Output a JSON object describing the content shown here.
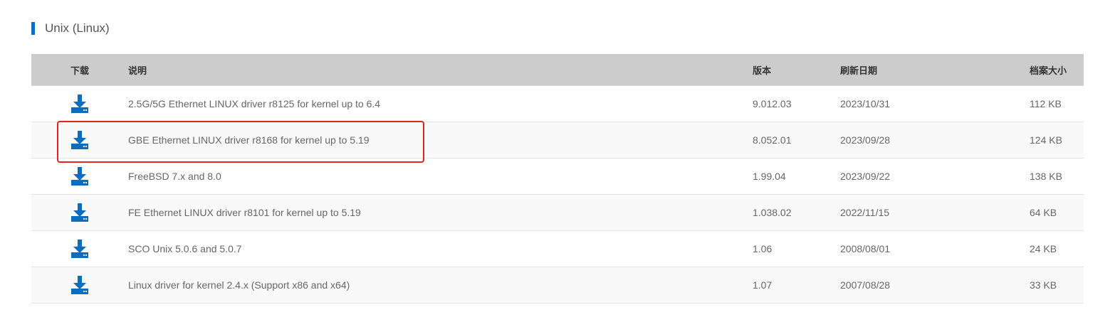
{
  "section": {
    "title": "Unix (Linux)"
  },
  "table": {
    "headers": {
      "download": "下载",
      "description": "说明",
      "version": "版本",
      "date": "刷新日期",
      "size": "档案大小"
    },
    "rows": [
      {
        "description": "2.5G/5G Ethernet LINUX driver r8125 for kernel up to 6.4",
        "version": "9.012.03",
        "date": "2023/10/31",
        "size": "112 KB"
      },
      {
        "description": "GBE Ethernet LINUX driver r8168 for kernel up to 5.19",
        "version": "8.052.01",
        "date": "2023/09/28",
        "size": "124 KB"
      },
      {
        "description": "FreeBSD 7.x and 8.0",
        "version": "1.99.04",
        "date": "2023/09/22",
        "size": "138 KB"
      },
      {
        "description": "FE Ethernet LINUX driver r8101 for kernel up to 5.19",
        "version": "1.038.02",
        "date": "2022/11/15",
        "size": "64 KB"
      },
      {
        "description": "SCO Unix 5.0.6 and 5.0.7",
        "version": "1.06",
        "date": "2008/08/01",
        "size": "24 KB"
      },
      {
        "description": "Linux driver for kernel 2.4.x (Support x86 and x64)",
        "version": "1.07",
        "date": "2007/08/28",
        "size": "33 KB"
      }
    ]
  },
  "colors": {
    "accent": "#0a6dbf",
    "header_bg": "#cccccc",
    "highlight": "#e5221f"
  },
  "icons": {
    "download": "download-icon"
  }
}
